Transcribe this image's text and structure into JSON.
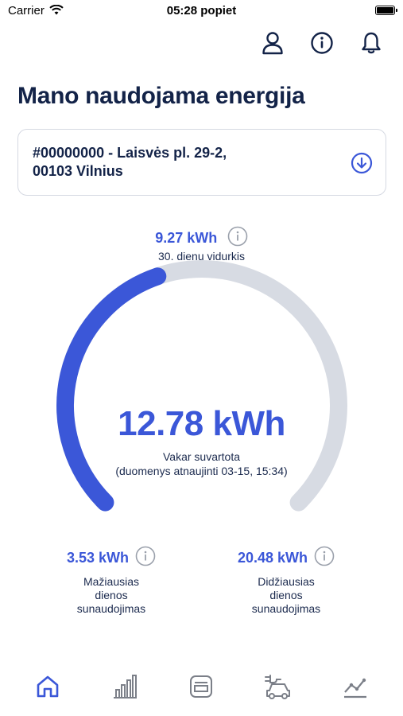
{
  "status_bar": {
    "carrier": "Carrier",
    "time": "05:28 popiet"
  },
  "header_icons": [
    "user-icon",
    "info-icon",
    "bell-icon"
  ],
  "page_title": "Mano naudojama energija",
  "address": {
    "text": "#00000000 - Laisvės pl. 29-2,\n00103 Vilnius",
    "icon": "arrow-down-circle-icon"
  },
  "average": {
    "value": "9.27 kWh",
    "label": "30. dienų vidurkis"
  },
  "gauge": {
    "fraction": 0.43,
    "active_color": "#3b57d8",
    "track_color": "#d7dbe3"
  },
  "main": {
    "value": "12.78 kWh",
    "label": "Vakar suvartota",
    "sub": "(duomenys atnaujinti 03-15, 15:34)"
  },
  "min_stat": {
    "value": "3.53 kWh",
    "label": "Mažiausias\ndienos\nsunaudojimas"
  },
  "max_stat": {
    "value": "20.48 kWh",
    "label": "Didžiausias\ndienos\nsunaudojimas"
  },
  "tabs": [
    {
      "icon": "home-icon",
      "active": true
    },
    {
      "icon": "bar-chart-icon",
      "active": false
    },
    {
      "icon": "invoice-icon",
      "active": false
    },
    {
      "icon": "ev-car-icon",
      "active": false
    },
    {
      "icon": "trend-chart-icon",
      "active": false
    }
  ],
  "colors": {
    "accent": "#3b57d8",
    "inactive_icon": "#7b7f88",
    "title": "#132348"
  }
}
